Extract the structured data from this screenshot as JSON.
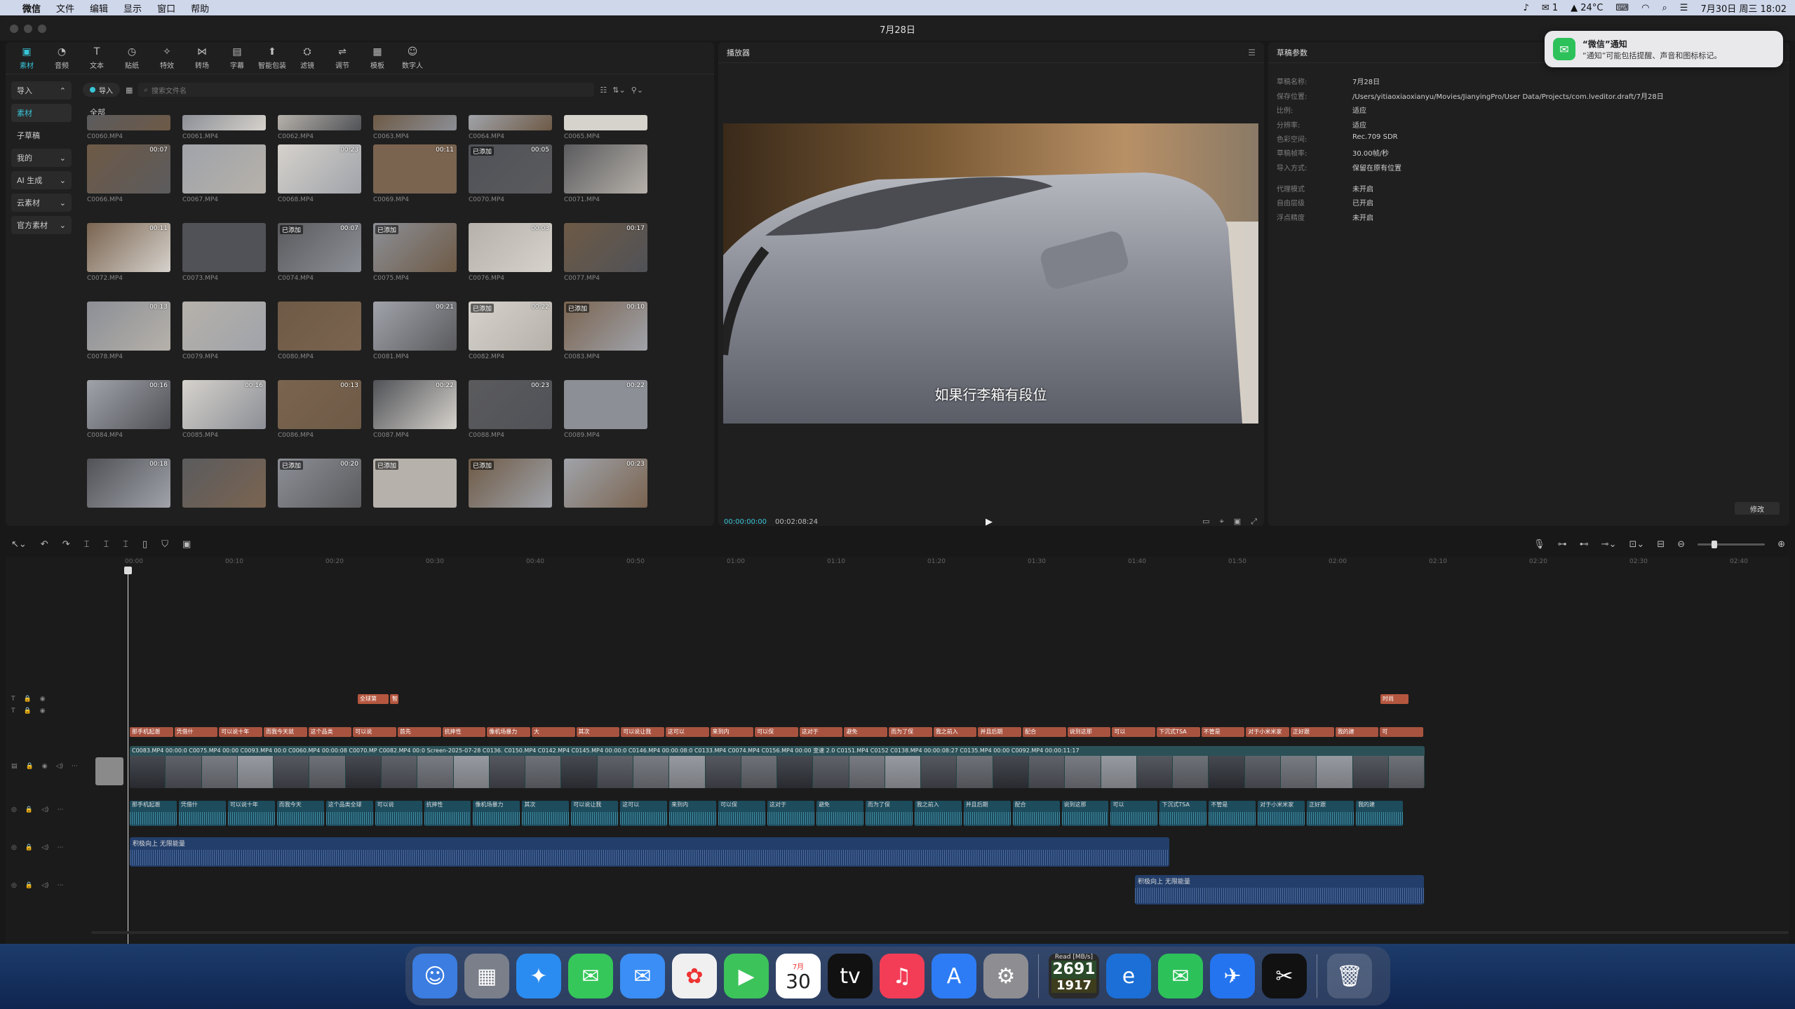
{
  "menubar": {
    "app_name": "微信",
    "items": [
      "文件",
      "编辑",
      "显示",
      "窗口",
      "帮助"
    ],
    "wechat_count": "1",
    "weather": "24°C",
    "datetime": "7月30日 周三 18:02"
  },
  "window": {
    "title": "7月28日"
  },
  "toolbar": [
    {
      "label": "素材",
      "icon": "media-icon"
    },
    {
      "label": "音频",
      "icon": "audio-icon"
    },
    {
      "label": "文本",
      "icon": "text-icon"
    },
    {
      "label": "贴纸",
      "icon": "sticker-icon"
    },
    {
      "label": "特效",
      "icon": "effect-icon"
    },
    {
      "label": "转场",
      "icon": "transition-icon"
    },
    {
      "label": "字幕",
      "icon": "caption-icon"
    },
    {
      "label": "智能包装",
      "icon": "smart-pack-icon"
    },
    {
      "label": "滤镜",
      "icon": "filter-icon"
    },
    {
      "label": "调节",
      "icon": "adjust-icon"
    },
    {
      "label": "模板",
      "icon": "template-icon"
    },
    {
      "label": "数字人",
      "icon": "avatar-icon"
    }
  ],
  "side_nav": [
    "导入",
    "素材",
    "子草稿",
    "我的",
    "AI 生成",
    "云素材",
    "官方素材"
  ],
  "filter": {
    "import_label": "导入",
    "search_placeholder": "搜索文件名"
  },
  "media": {
    "group_label": "全部",
    "rows": [
      [
        {
          "name": "C0060.MP4",
          "dur": "",
          "added": ""
        },
        {
          "name": "C0061.MP4",
          "dur": "",
          "added": ""
        },
        {
          "name": "C0062.MP4",
          "dur": "",
          "added": ""
        },
        {
          "name": "C0063.MP4",
          "dur": "",
          "added": ""
        },
        {
          "name": "C0064.MP4",
          "dur": "",
          "added": ""
        },
        {
          "name": "C0065.MP4",
          "dur": "",
          "added": ""
        }
      ],
      [
        {
          "name": "C0066.MP4",
          "dur": "00:07",
          "added": ""
        },
        {
          "name": "C0067.MP4",
          "dur": "",
          "added": ""
        },
        {
          "name": "C0068.MP4",
          "dur": "00:23",
          "added": ""
        },
        {
          "name": "C0069.MP4",
          "dur": "00:11",
          "added": ""
        },
        {
          "name": "C0070.MP4",
          "dur": "00:05",
          "added": "已添加"
        },
        {
          "name": "C0071.MP4",
          "dur": "",
          "added": ""
        }
      ],
      [
        {
          "name": "C0072.MP4",
          "dur": "00:11",
          "added": ""
        },
        {
          "name": "C0073.MP4",
          "dur": "",
          "added": ""
        },
        {
          "name": "C0074.MP4",
          "dur": "00:07",
          "added": "已添加"
        },
        {
          "name": "C0075.MP4",
          "dur": "",
          "added": "已添加"
        },
        {
          "name": "C0076.MP4",
          "dur": "00:03",
          "added": ""
        },
        {
          "name": "C0077.MP4",
          "dur": "00:17",
          "added": ""
        }
      ],
      [
        {
          "name": "C0078.MP4",
          "dur": "00:13",
          "added": ""
        },
        {
          "name": "C0079.MP4",
          "dur": "",
          "added": ""
        },
        {
          "name": "C0080.MP4",
          "dur": "",
          "added": ""
        },
        {
          "name": "C0081.MP4",
          "dur": "00:21",
          "added": ""
        },
        {
          "name": "C0082.MP4",
          "dur": "00:22",
          "added": "已添加"
        },
        {
          "name": "C0083.MP4",
          "dur": "00:10",
          "added": "已添加"
        }
      ],
      [
        {
          "name": "C0084.MP4",
          "dur": "00:16",
          "added": ""
        },
        {
          "name": "C0085.MP4",
          "dur": "00:16",
          "added": ""
        },
        {
          "name": "C0086.MP4",
          "dur": "00:13",
          "added": ""
        },
        {
          "name": "C0087.MP4",
          "dur": "00:22",
          "added": ""
        },
        {
          "name": "C0088.MP4",
          "dur": "00:23",
          "added": ""
        },
        {
          "name": "C0089.MP4",
          "dur": "00:22",
          "added": ""
        }
      ],
      [
        {
          "name": "",
          "dur": "00:18",
          "added": ""
        },
        {
          "name": "",
          "dur": "",
          "added": ""
        },
        {
          "name": "",
          "dur": "00:20",
          "added": "已添加"
        },
        {
          "name": "",
          "dur": "",
          "added": "已添加"
        },
        {
          "name": "",
          "dur": "",
          "added": "已添加"
        },
        {
          "name": "",
          "dur": "00:23",
          "added": ""
        }
      ]
    ]
  },
  "player": {
    "title": "播放器",
    "subtitle": "如果行李箱有段位",
    "current_time": "00:00:00:00",
    "total_time": "00:02:08:24"
  },
  "params": {
    "title": "草稿参数",
    "rows": [
      {
        "k": "草稿名称:",
        "v": "7月28日"
      },
      {
        "k": "保存位置:",
        "v": "/Users/yitiaoxiaoxianyu/Movies/JianyingPro/User Data/Projects/com.lveditor.draft/7月28日"
      },
      {
        "k": "比例:",
        "v": "适应"
      },
      {
        "k": "分辨率:",
        "v": "适应"
      },
      {
        "k": "色彩空间:",
        "v": "Rec.709 SDR"
      },
      {
        "k": "草稿帧率:",
        "v": "30.00帧/秒"
      },
      {
        "k": "导入方式:",
        "v": "保留在原有位置"
      },
      {
        "k": "代理模式",
        "v": "未开启"
      },
      {
        "k": "自由层级",
        "v": "已开启"
      },
      {
        "k": "浮点精度",
        "v": "未开启"
      }
    ],
    "modify_label": "修改"
  },
  "notification": {
    "title": "“微信”通知",
    "body": "“通知”可能包括提醒、声音和图标标记。"
  },
  "timeline": {
    "ruler": [
      "00:00",
      "00:10",
      "00:20",
      "00:30",
      "00:40",
      "00:50",
      "01:00",
      "01:10",
      "01:20",
      "01:30",
      "01:40",
      "01:50",
      "02:00",
      "02:10",
      "02:20",
      "02:30",
      "02:40"
    ],
    "title_clips": [
      "全球第",
      "智",
      "时尚"
    ],
    "caption_clips": [
      "那手机起潮",
      "凭借什",
      "可以说十年",
      "而我今天就",
      "这个品类",
      "可以说",
      "首先",
      "抗摔性",
      "像机场暴力",
      "大",
      "其次",
      "可以说让我",
      "这可以",
      "来到内",
      "可以保",
      "这对于",
      "避免",
      "而为了保",
      "我之前入",
      "并且后期",
      "配合",
      "说到这那",
      "可以",
      "下沉式TSA",
      "不管是",
      "对于小米米家",
      "正好跟",
      "我的建",
      "可"
    ],
    "video_names": "C0083.MP4  00:00:0  C0075.MP4  00:00  C0093.MP4  00:0  C0060.MP4  00:00:08  C0070.MP  C0082.MP4  00:0  Screen-2025-07-28  C0136.  C0150.MP4  C0142.MP4  C0145.MP4  00:00:0  C0146.MP4  00:00:08:0  C0133.MP4  C0074.MP4  C0156.MP4  00:00  变速 2.0  C0151.MP4  C0152  C0138.MP4  00:00:08:27  C0135.MP4  00:00  C0092.MP4  00:00:11:17",
    "audio_clips": [
      "那手机起潮",
      "凭借什",
      "可以说十年",
      "而我今天",
      "这个品类全球",
      "可以说",
      "抗摔性",
      "像机场暴力",
      "其次",
      "可以说让我",
      "这可以",
      "来到内",
      "可以保",
      "这对于",
      "避免",
      "而为了保",
      "我之前入",
      "并且后期",
      "配合",
      "说到这那",
      "可以",
      "下沉式TSA",
      "不管是",
      "对于小米米家",
      "正好跟",
      "我的建"
    ],
    "music1": "积极向上 无限能量",
    "music2": "积极向上 无限能量"
  },
  "dock": {
    "calendar_month": "7月",
    "calendar_day": "30",
    "stat_label": "Read [MB/s]",
    "stat_value1": "2691",
    "stat_value2": "1917"
  }
}
